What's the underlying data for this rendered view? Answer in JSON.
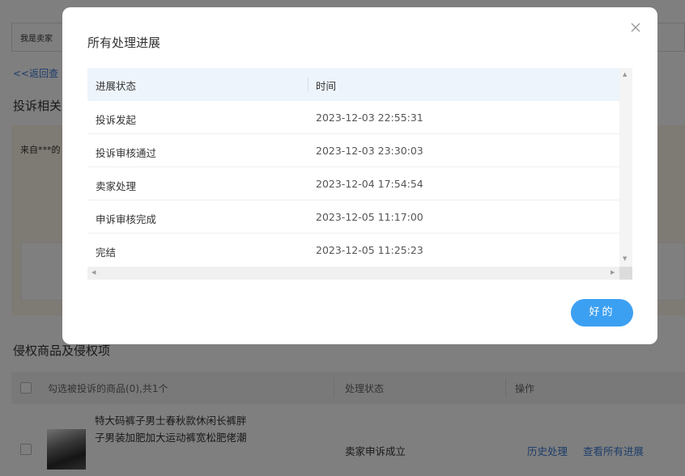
{
  "background": {
    "top_tab": "我是卖家",
    "back_link": "<<返回查",
    "complaint_section_title": "投诉相关",
    "notice_text": "来自***的",
    "infringe_section_title": "侵权商品及侵权项",
    "product_table": {
      "select_header": "勾选被投诉的商品(0),共1个",
      "status_header": "处理状态",
      "action_header": "操作",
      "row": {
        "name": "特大码裤子男士春秋款休闲长裤胖子男装加肥加大运动裤宽松肥佬潮",
        "status": "卖家申诉成立",
        "link_history": "历史处理",
        "link_progress": "查看所有进展"
      }
    }
  },
  "dialog": {
    "title": "所有处理进展",
    "columns": [
      "进展状态",
      "时间"
    ],
    "rows": [
      {
        "status": "投诉发起",
        "time": "2023-12-03 22:55:31"
      },
      {
        "status": "投诉审核通过",
        "time": "2023-12-03 23:30:03"
      },
      {
        "status": "卖家处理",
        "time": "2023-12-04 17:54:54"
      },
      {
        "status": "申诉审核完成",
        "time": "2023-12-05 11:17:00"
      },
      {
        "status": "完结",
        "time": "2023-12-05 11:25:23"
      }
    ],
    "ok_label": "好的",
    "close_icon": "close-icon"
  },
  "colors": {
    "accent": "#3ca0f2",
    "link": "#3a7bd5",
    "table_header_bg": "#edf4fc",
    "notice_bg": "#fdf5e8"
  }
}
